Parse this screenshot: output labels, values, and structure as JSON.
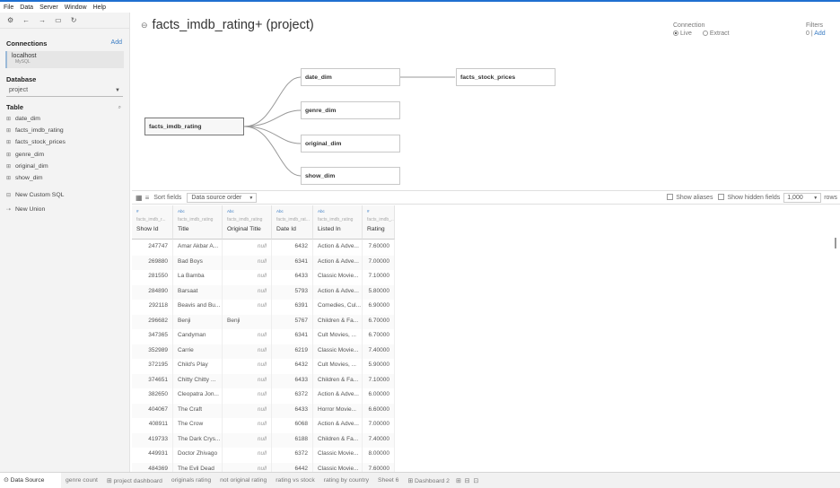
{
  "menu": [
    "File",
    "Data",
    "Server",
    "Window",
    "Help"
  ],
  "sidebar": {
    "connections_title": "Connections",
    "connections_add": "Add",
    "connection": {
      "name": "localhost",
      "type": "MySQL"
    },
    "database_title": "Database",
    "database_value": "project",
    "table_title": "Table",
    "tables": [
      "date_dim",
      "facts_imdb_rating",
      "facts_stock_prices",
      "genre_dim",
      "original_dim",
      "show_dim"
    ],
    "new_custom_sql": "New Custom SQL",
    "new_union": "New Union"
  },
  "header": {
    "title": "facts_imdb_rating+ (project)",
    "connection_label": "Connection",
    "live": "Live",
    "extract": "Extract",
    "filters_label": "Filters",
    "filters_count": "0",
    "filters_sep": "|",
    "filters_add": "Add"
  },
  "canvas": {
    "main_table": "facts_imdb_rating",
    "joined": [
      "date_dim",
      "genre_dim",
      "original_dim",
      "show_dim"
    ],
    "second_level": "facts_stock_prices"
  },
  "grid_toolbar": {
    "sort_label": "Sort fields",
    "sort_value": "Data source order",
    "show_aliases": "Show aliases",
    "show_hidden": "Show hidden fields",
    "rows_value": "1,000",
    "rows_label": "rows"
  },
  "grid": {
    "columns": [
      {
        "type": "#",
        "source": "facts_imdb_r...",
        "name": "Show Id"
      },
      {
        "type": "Abc",
        "source": "facts_imdb_rating",
        "name": "Title"
      },
      {
        "type": "Abc",
        "source": "facts_imdb_rating",
        "name": "Original Title"
      },
      {
        "type": "Abc",
        "source": "facts_imdb_rat...",
        "name": "Date Id"
      },
      {
        "type": "Abc",
        "source": "facts_imdb_rating",
        "name": "Listed In"
      },
      {
        "type": "#",
        "source": "facts_imdb_...",
        "name": "Rating"
      }
    ],
    "rows": [
      [
        "247747",
        "Amar Akbar A...",
        "null",
        "6432",
        "Action & Adve...",
        "7.60000"
      ],
      [
        "269880",
        "Bad Boys",
        "null",
        "6341",
        "Action & Adve...",
        "7.00000"
      ],
      [
        "281550",
        "La Bamba",
        "null",
        "6433",
        "Classic Movie...",
        "7.10000"
      ],
      [
        "284890",
        "Barsaat",
        "null",
        "5793",
        "Action & Adve...",
        "5.80000"
      ],
      [
        "292118",
        "Beavis and Bu...",
        "null",
        "6391",
        "Comedies, Cul...",
        "6.90000"
      ],
      [
        "296682",
        "Benji",
        "Benji",
        "5767",
        "Children & Fa...",
        "6.70000"
      ],
      [
        "347365",
        "Candyman",
        "null",
        "6341",
        "Cult Movies, ...",
        "6.70000"
      ],
      [
        "352989",
        "Carrie",
        "null",
        "6219",
        "Classic Movie...",
        "7.40000"
      ],
      [
        "372195",
        "Child's Play",
        "null",
        "6432",
        "Cult Movies, ...",
        "5.90000"
      ],
      [
        "374651",
        "Chitty Chitty ...",
        "null",
        "6433",
        "Children & Fa...",
        "7.10000"
      ],
      [
        "382650",
        "Cleopatra Jon...",
        "null",
        "6372",
        "Action & Adve...",
        "6.00000"
      ],
      [
        "404067",
        "The Craft",
        "null",
        "6433",
        "Horror Movie...",
        "6.60000"
      ],
      [
        "408911",
        "The Crow",
        "null",
        "6068",
        "Action & Adve...",
        "7.00000"
      ],
      [
        "419733",
        "The Dark Crys...",
        "null",
        "6188",
        "Children & Fa...",
        "7.40000"
      ],
      [
        "449931",
        "Doctor Zhivago",
        "null",
        "6372",
        "Classic Movie...",
        "8.00000"
      ],
      [
        "484369",
        "The Evil Dead",
        "null",
        "6442",
        "Classic Movie...",
        "7.60000"
      ]
    ]
  },
  "tabs": {
    "data_source": "Data Source",
    "sheets": [
      "genre count",
      "project dashboard",
      "originals rating",
      "not original rating",
      "rating vs stock",
      "rating by country",
      "Sheet 6",
      "Dashboard 2"
    ]
  }
}
